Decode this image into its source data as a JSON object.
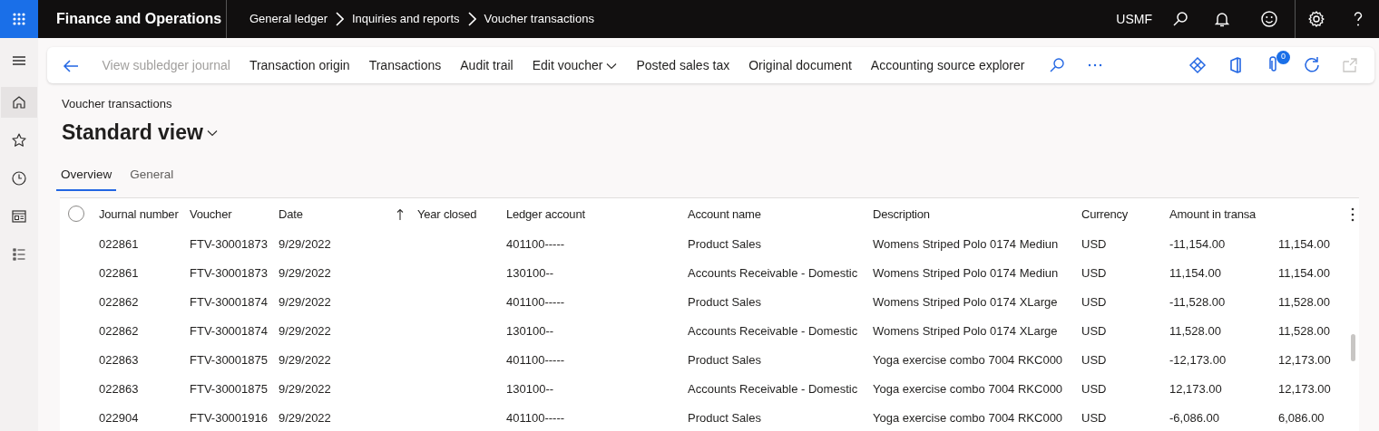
{
  "app": {
    "title": "Finance and Operations",
    "company": "USMF"
  },
  "breadcrumb": [
    "General ledger",
    "Inquiries and reports",
    "Voucher transactions"
  ],
  "rail": [
    {
      "kind": "menu",
      "selected": false
    },
    {
      "kind": "home",
      "selected": true
    },
    {
      "kind": "star",
      "selected": false
    },
    {
      "kind": "clock",
      "selected": false
    },
    {
      "kind": "workspace",
      "selected": false
    },
    {
      "kind": "list",
      "selected": false
    }
  ],
  "toolbar": {
    "actions": [
      {
        "label": "View subledger journal",
        "disabled": true,
        "dropdown": false
      },
      {
        "label": "Transaction origin",
        "disabled": false,
        "dropdown": false
      },
      {
        "label": "Transactions",
        "disabled": false,
        "dropdown": false
      },
      {
        "label": "Audit trail",
        "disabled": false,
        "dropdown": false
      },
      {
        "label": "Edit voucher",
        "disabled": false,
        "dropdown": true
      },
      {
        "label": "Posted sales tax",
        "disabled": false,
        "dropdown": false
      },
      {
        "label": "Original document",
        "disabled": false,
        "dropdown": false
      },
      {
        "label": "Accounting source explorer",
        "disabled": false,
        "dropdown": false
      }
    ],
    "attachment_count": "0"
  },
  "page": {
    "caption": "Voucher transactions",
    "view": "Standard view"
  },
  "tabs": [
    {
      "label": "Overview",
      "selected": true
    },
    {
      "label": "General",
      "selected": false
    }
  ],
  "table": {
    "all_selected": false,
    "columns": [
      {
        "label": "Journal number",
        "sorted": false
      },
      {
        "label": "Voucher",
        "sorted": false
      },
      {
        "label": "Date",
        "sorted": true
      },
      {
        "label": "Year closed",
        "sorted": false
      },
      {
        "label": "Ledger account",
        "sorted": false
      },
      {
        "label": "Account name",
        "sorted": false
      },
      {
        "label": "Description",
        "sorted": false
      },
      {
        "label": "Currency",
        "sorted": false
      },
      {
        "label": "Amount in transa",
        "sorted": false
      }
    ],
    "rows": [
      [
        "022861",
        "FTV-30001873",
        "9/29/2022",
        "",
        "401100-----",
        "Product Sales",
        "Womens Striped Polo 0174 Mediun",
        "USD",
        "-11,154.00",
        "11,154.00"
      ],
      [
        "022861",
        "FTV-30001873",
        "9/29/2022",
        "",
        "130100--",
        "Accounts Receivable - Domestic",
        "Womens Striped Polo 0174 Mediun",
        "USD",
        "11,154.00",
        "11,154.00"
      ],
      [
        "022862",
        "FTV-30001874",
        "9/29/2022",
        "",
        "401100-----",
        "Product Sales",
        "Womens Striped Polo 0174 XLarge",
        "USD",
        "-11,528.00",
        "11,528.00"
      ],
      [
        "022862",
        "FTV-30001874",
        "9/29/2022",
        "",
        "130100--",
        "Accounts Receivable - Domestic",
        "Womens Striped Polo 0174 XLarge",
        "USD",
        "11,528.00",
        "11,528.00"
      ],
      [
        "022863",
        "FTV-30001875",
        "9/29/2022",
        "",
        "401100-----",
        "Product Sales",
        "Yoga exercise combo 7004 RKC000",
        "USD",
        "-12,173.00",
        "12,173.00"
      ],
      [
        "022863",
        "FTV-30001875",
        "9/29/2022",
        "",
        "130100--",
        "Accounts Receivable - Domestic",
        "Yoga exercise combo 7004 RKC000",
        "USD",
        "12,173.00",
        "12,173.00"
      ],
      [
        "022904",
        "FTV-30001916",
        "9/29/2022",
        "",
        "401100-----",
        "Product Sales",
        "Yoga exercise combo 7004 RKC000",
        "USD",
        "-6,086.00",
        "6,086.00"
      ]
    ]
  }
}
